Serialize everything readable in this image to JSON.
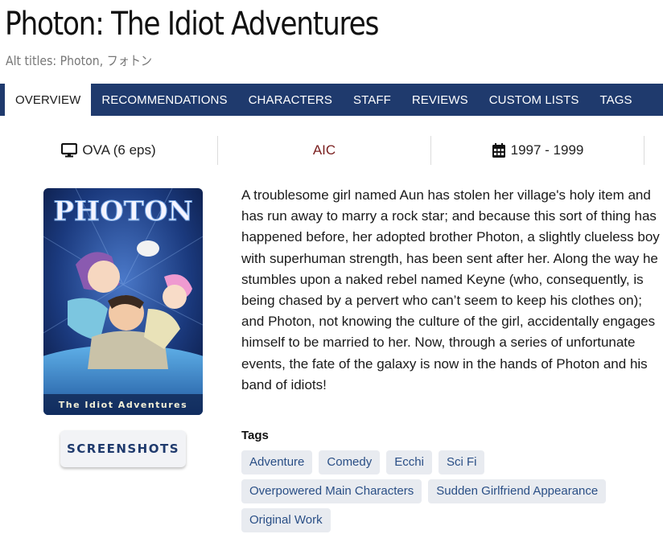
{
  "title": "Photon: The Idiot Adventures",
  "alt_titles": "Alt titles: Photon, フォトン",
  "tabs": [
    {
      "label": "OVERVIEW",
      "active": true
    },
    {
      "label": "RECOMMENDATIONS"
    },
    {
      "label": "CHARACTERS"
    },
    {
      "label": "STAFF"
    },
    {
      "label": "REVIEWS"
    },
    {
      "label": "CUSTOM LISTS"
    },
    {
      "label": "TAGS"
    }
  ],
  "info": {
    "format": "OVA (6 eps)",
    "format_icon": "monitor-icon",
    "studio": "AIC",
    "years": "1997 - 1999",
    "years_icon": "calendar-icon"
  },
  "cover": {
    "logo": "PHOTON",
    "subtitle": "The Idiot Adventures"
  },
  "screenshots_label": "SCREENSHOTS",
  "description": "A troublesome girl named Aun has stolen her village's holy item and has run away to marry a rock star; and because this sort of thing has happened before, her adopted brother Photon, a slightly clueless boy with superhuman strength, has been sent after her. Along the way he stumbles upon a naked rebel named Keyne (who, consequently, is being chased by a pervert who can’t seem to keep his clothes on); and Photon, not knowing the culture of the girl, accidentally engages himself to be married to her. Now, through a series of unfortunate events, the fate of the galaxy is now in the hands of Photon and his band of idiots!",
  "tags_heading": "Tags",
  "tags": [
    "Adventure",
    "Comedy",
    "Ecchi",
    "Sci Fi",
    "Overpowered Main Characters",
    "Sudden Girlfriend Appearance",
    "Original Work"
  ],
  "colors": {
    "nav": "#1f3a6d",
    "studio": "#7a1f1f",
    "tag_bg": "#e8ebf0",
    "tag_text": "#2a4f86"
  }
}
